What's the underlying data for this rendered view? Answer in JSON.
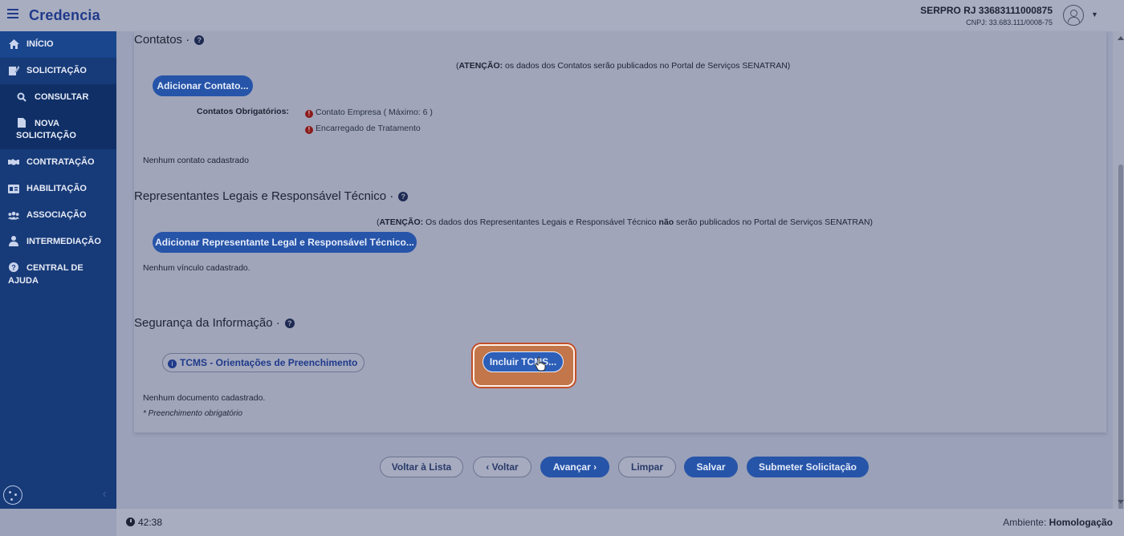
{
  "app": {
    "title": "Credencia",
    "org_name": "SERPRO RJ 33683111000875",
    "org_cnpj": "CNPJ: 33.683.111/0008-75"
  },
  "sidebar": {
    "items": [
      {
        "label": "INÍCIO",
        "icon": "home-icon"
      },
      {
        "label": "SOLICITAÇÃO",
        "icon": "edit-icon"
      },
      {
        "label": "CONSULTAR",
        "icon": "search-icon"
      },
      {
        "label": "NOVA",
        "label2": "SOLICITAÇÃO",
        "icon": "file-icon"
      },
      {
        "label": "CONTRATAÇÃO",
        "icon": "handshake-icon"
      },
      {
        "label": "HABILITAÇÃO",
        "icon": "id-card-icon"
      },
      {
        "label": "ASSOCIAÇÃO",
        "icon": "users-icon"
      },
      {
        "label": "INTERMEDIAÇÃO",
        "icon": "user-tie-icon"
      },
      {
        "label": "CENTRAL DE",
        "label2": "AJUDA",
        "icon": "help-circle-icon"
      }
    ]
  },
  "contatos": {
    "title": "Contatos ·",
    "attention_bold": "ATENÇÃO:",
    "attention_text": " os dados dos Contatos serão publicados no Portal de Serviços SENATRAN)",
    "add_button": "Adicionar Contato...",
    "required_label": "Contatos Obrigatórios:",
    "required": [
      "Contato Empresa ( Máximo: 6 )",
      "Encarregado de Tratamento"
    ],
    "empty": "Nenhum contato cadastrado"
  },
  "representantes": {
    "title": "Representantes Legais e Responsável Técnico ·",
    "attention_bold": "ATENÇÃO:",
    "attention_text_1": " Os dados dos Representantes Legais e Responsável Técnico ",
    "attention_bold_2": "não",
    "attention_text_2": " serão publicados no Portal de Serviços SENATRAN)",
    "add_button": "Adicionar Representante Legal e Responsável Técnico...",
    "empty": "Nenhum vínculo cadastrado."
  },
  "seguranca": {
    "title": "Segurança da Informação ·",
    "tcms_info": "TCMS - Orientações de Preenchimento",
    "include_button": "Incluir TCMS...",
    "empty": "Nenhum documento cadastrado.",
    "required_note": "* Preenchimento obrigatório"
  },
  "actions": {
    "back_list": "Voltar à Lista",
    "back": "Voltar",
    "next": "Avançar",
    "clear": "Limpar",
    "save": "Salvar",
    "submit": "Submeter Solicitação"
  },
  "footer": {
    "timer": "42:38",
    "env_label": "Ambiente:",
    "env_value": "Homologação"
  }
}
